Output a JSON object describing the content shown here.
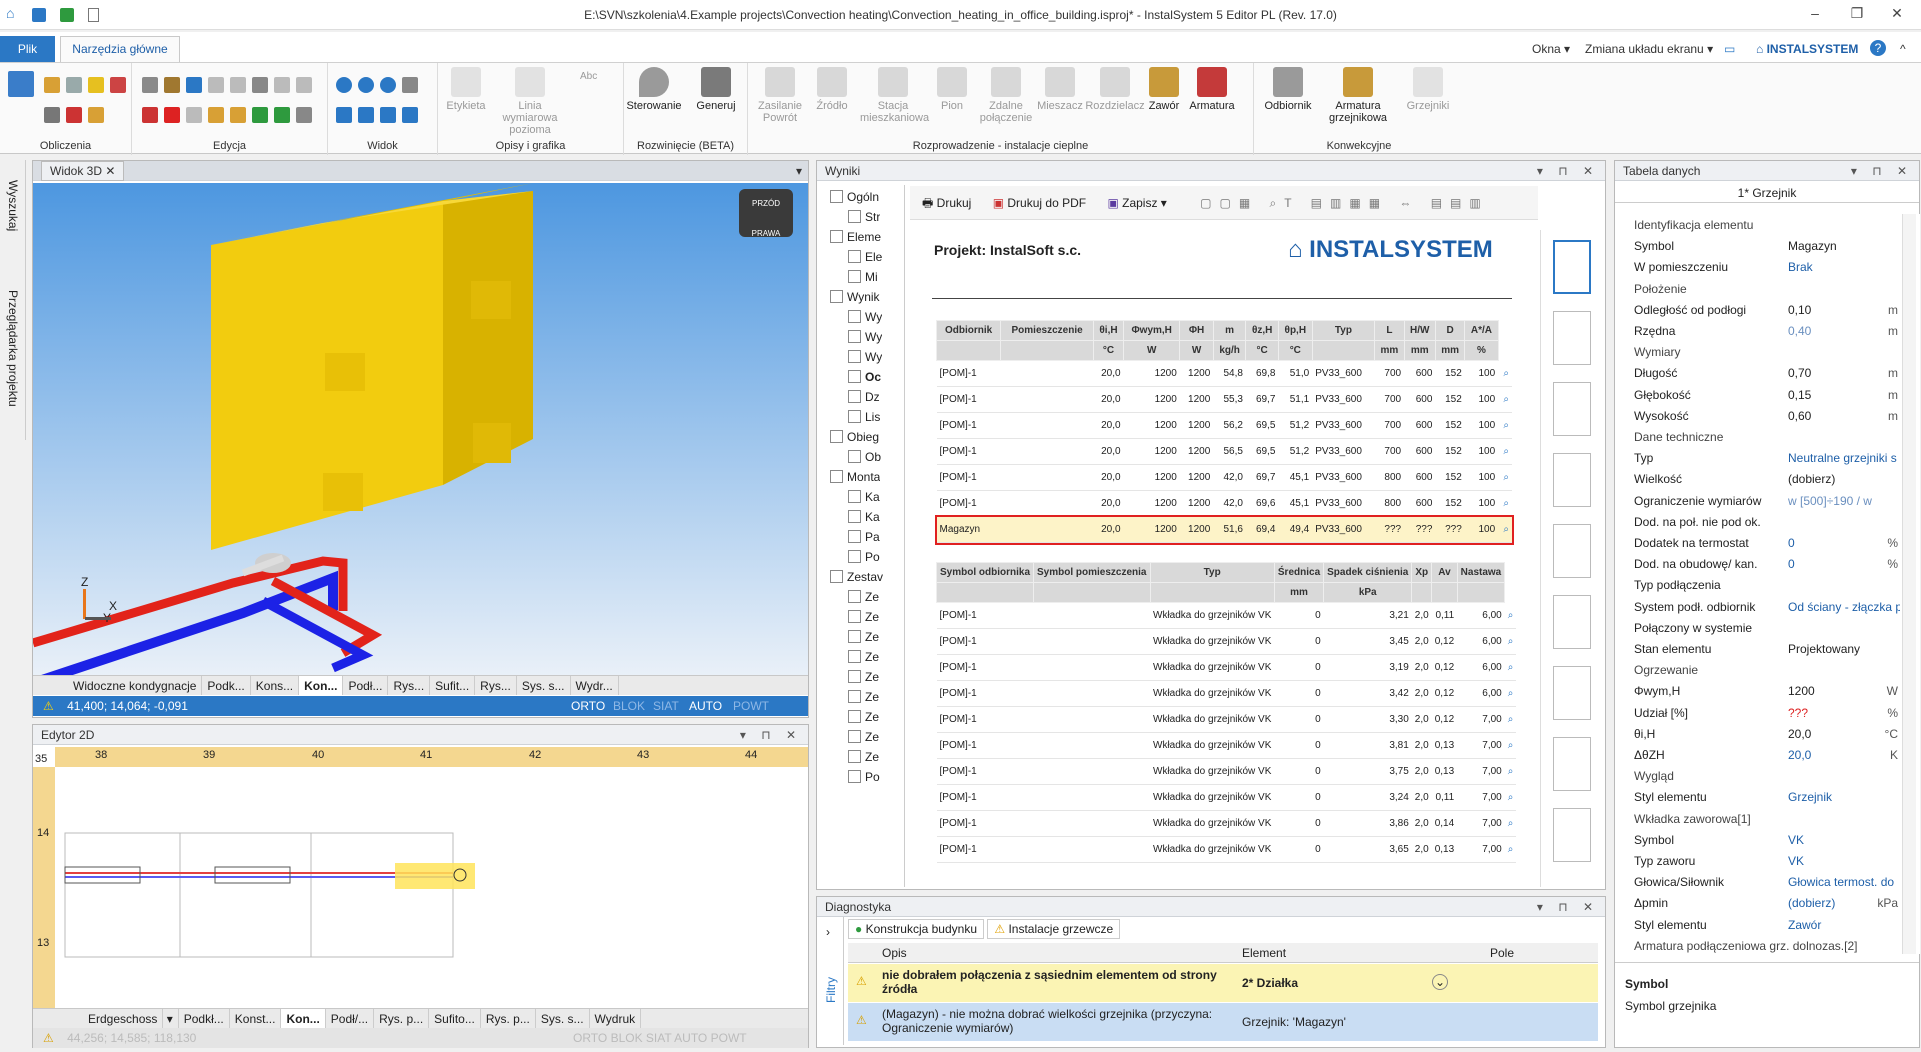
{
  "window": {
    "title": "E:\\SVN\\szkolenia\\4.Example projects\\Convection heating\\Convection_heating_in_office_building.isproj* - InstalSystem 5 Editor PL (Rev. 17.0)"
  },
  "ribbon_tabs": {
    "file": "Plik",
    "home": "Narzędzia główne",
    "okna": "Okna",
    "layout": "Zmiana układu ekranu",
    "brand": "INSTALSYSTEM"
  },
  "ribbon": {
    "groups": [
      "Obliczenia",
      "Edycja",
      "Widok",
      "Opisy i grafika",
      "Rozwinięcie (BETA)",
      "Rozprowadzenie - instalacje cieplne",
      "Konwekcyjne"
    ],
    "buttons": {
      "etykieta": "Etykieta",
      "linia": "Linia wymiarowa pozioma",
      "sterowanie": "Sterowanie",
      "generuj": "Generuj",
      "zasilanie": "Zasilanie Powrót",
      "zrodlo": "Źródło",
      "stacja": "Stacja mieszkaniowa",
      "pion": "Pion",
      "zdalne": "Zdalne połączenie",
      "mieszacz": "Mieszacz",
      "rozdzielacz": "Rozdzielacz",
      "zawor": "Zawór",
      "armatura": "Armatura",
      "odbiornik": "Odbiornik",
      "armatura_grz": "Armatura grzejnikowa",
      "grzejniki": "Grzejniki",
      "abc": "Abc"
    }
  },
  "sidebar": {
    "search": "Wyszukaj",
    "browser": "Przeglądarka projektu"
  },
  "view3d": {
    "tab": "Widok 3D",
    "cube_front": "PRZÓD",
    "cube_right": "PRAWA",
    "axes": [
      "Z",
      "X",
      "Y"
    ],
    "tabs": [
      "Widoczne kondygnacje",
      "Podk...",
      "Kons...",
      "Kon...",
      "Podł...",
      "Rys...",
      "Sufit...",
      "Rys...",
      "Sys. s...",
      "Wydr..."
    ],
    "coords": "41,400; 14,064; -0,091",
    "modes": [
      "ORTO",
      "BLOK",
      "SIAT",
      "AUTO",
      "POWT"
    ]
  },
  "editor2d": {
    "title": "Edytor 2D",
    "ruler": [
      "38",
      "39",
      "40",
      "41",
      "42",
      "43",
      "44"
    ],
    "vruler": [
      "35",
      "14",
      "13"
    ],
    "floor": "Erdgeschoss",
    "tabs": [
      "Podkł...",
      "Konst...",
      "Kon...",
      "Podł/...",
      "Rys. p...",
      "Sufito...",
      "Rys. p...",
      "Sys. s...",
      "Wydruk"
    ],
    "coords": "44,256; 14,585; 118,130",
    "modes": "ORTO BLOK SIAT AUTO POWT"
  },
  "results": {
    "title": "Wyniki",
    "toolbar": {
      "print": "Drukuj",
      "pdf": "Drukuj do PDF",
      "save": "Zapisz"
    },
    "tree": [
      "Ogóln",
      "Str",
      "Eleme",
      "Ele",
      "Mi",
      "Wynik",
      "Wy",
      "Wy",
      "Wy",
      "Oc",
      "Dz",
      "Lis",
      "Obieg",
      "Ob",
      "Monta",
      "Ka",
      "Ka",
      "Pa",
      "Po",
      "Zestav",
      "Ze",
      "Ze",
      "Ze",
      "Ze",
      "Ze",
      "Ze",
      "Ze",
      "Ze",
      "Ze",
      "Po"
    ],
    "project": "Projekt: InstalSoft s.c.",
    "logo": "INSTALSYSTEM",
    "table1": {
      "headers": [
        "Odbiornik",
        "Pomieszczenie",
        "θi,H",
        "Φwym,H",
        "ΦH",
        "m",
        "θz,H",
        "θp,H",
        "Typ",
        "L",
        "H/W",
        "D",
        "A*/A"
      ],
      "units": [
        "",
        "",
        "°C",
        "W",
        "W",
        "kg/h",
        "°C",
        "°C",
        "",
        "mm",
        "mm",
        "mm",
        "%"
      ],
      "rows": [
        [
          "[POM]-1",
          "",
          "20,0",
          "1200",
          "1200",
          "54,8",
          "69,8",
          "51,0",
          "PV33_600",
          "700",
          "600",
          "152",
          "100"
        ],
        [
          "[POM]-1",
          "",
          "20,0",
          "1200",
          "1200",
          "55,3",
          "69,7",
          "51,1",
          "PV33_600",
          "700",
          "600",
          "152",
          "100"
        ],
        [
          "[POM]-1",
          "",
          "20,0",
          "1200",
          "1200",
          "56,2",
          "69,5",
          "51,2",
          "PV33_600",
          "700",
          "600",
          "152",
          "100"
        ],
        [
          "[POM]-1",
          "",
          "20,0",
          "1200",
          "1200",
          "56,5",
          "69,5",
          "51,2",
          "PV33_600",
          "700",
          "600",
          "152",
          "100"
        ],
        [
          "[POM]-1",
          "",
          "20,0",
          "1200",
          "1200",
          "42,0",
          "69,7",
          "45,1",
          "PV33_600",
          "800",
          "600",
          "152",
          "100"
        ],
        [
          "[POM]-1",
          "",
          "20,0",
          "1200",
          "1200",
          "42,0",
          "69,6",
          "45,1",
          "PV33_600",
          "800",
          "600",
          "152",
          "100"
        ],
        [
          "Magazyn",
          "",
          "20,0",
          "1200",
          "1200",
          "51,6",
          "69,4",
          "49,4",
          "PV33_600",
          "???",
          "???",
          "???",
          "100"
        ]
      ]
    },
    "table2": {
      "headers": [
        "Symbol odbiornika",
        "Symbol pomieszczenia",
        "Typ",
        "Średnica",
        "Spadek ciśnienia",
        "Xp",
        "Av",
        "Nastawa"
      ],
      "units": [
        "",
        "",
        "",
        "mm",
        "kPa",
        "",
        "",
        ""
      ],
      "rows": [
        [
          "[POM]-1",
          "",
          "Wkładka do grzejników VK",
          "0",
          "3,21",
          "2,0",
          "0,11",
          "6,00"
        ],
        [
          "[POM]-1",
          "",
          "Wkładka do grzejników VK",
          "0",
          "3,45",
          "2,0",
          "0,12",
          "6,00"
        ],
        [
          "[POM]-1",
          "",
          "Wkładka do grzejników VK",
          "0",
          "3,19",
          "2,0",
          "0,12",
          "6,00"
        ],
        [
          "[POM]-1",
          "",
          "Wkładka do grzejników VK",
          "0",
          "3,42",
          "2,0",
          "0,12",
          "6,00"
        ],
        [
          "[POM]-1",
          "",
          "Wkładka do grzejników VK",
          "0",
          "3,30",
          "2,0",
          "0,12",
          "7,00"
        ],
        [
          "[POM]-1",
          "",
          "Wkładka do grzejników VK",
          "0",
          "3,81",
          "2,0",
          "0,13",
          "7,00"
        ],
        [
          "[POM]-1",
          "",
          "Wkładka do grzejników VK",
          "0",
          "3,75",
          "2,0",
          "0,13",
          "7,00"
        ],
        [
          "[POM]-1",
          "",
          "Wkładka do grzejników VK",
          "0",
          "3,24",
          "2,0",
          "0,11",
          "7,00"
        ],
        [
          "[POM]-1",
          "",
          "Wkładka do grzejników VK",
          "0",
          "3,86",
          "2,0",
          "0,14",
          "7,00"
        ],
        [
          "[POM]-1",
          "",
          "Wkładka do grzejników VK",
          "0",
          "3,65",
          "2,0",
          "0,13",
          "7,00"
        ]
      ]
    }
  },
  "diagnostics": {
    "title": "Diagnostyka",
    "tab1": "Konstrukcja budynku",
    "tab2": "Instalacje grzewcze",
    "filters": "Filtry",
    "headers": [
      "Opis",
      "Element",
      "Pole"
    ],
    "rows": [
      {
        "opis": "nie dobrałem połączenia z sąsiednim elementem od strony źródła",
        "element": "2* Działka"
      },
      {
        "opis": "(Magazyn) - nie można dobrać wielkości grzejnika (przyczyna: Ograniczenie wymiarów)",
        "element": "Grzejnik: 'Magazyn'"
      }
    ]
  },
  "props": {
    "title": "Tabela danych",
    "object": "1* Grzejnik",
    "items": [
      {
        "cat": "Identyfikacja elementu"
      },
      {
        "l": "Symbol",
        "v": "Magazyn",
        "c": "#222"
      },
      {
        "l": "W pomieszczeniu",
        "v": "Brak"
      },
      {
        "cat": "Położenie"
      },
      {
        "l": "Odległość od podłogi",
        "v": "0,10",
        "u": "m",
        "c": "#222"
      },
      {
        "l": "Rzędna",
        "v": "0,40",
        "u": "m",
        "c": "#6a8fbf"
      },
      {
        "cat": "Wymiary"
      },
      {
        "l": "Długość",
        "v": "0,70",
        "u": "m",
        "c": "#222"
      },
      {
        "l": "Głębokość",
        "v": "0,15",
        "u": "m",
        "c": "#222"
      },
      {
        "l": "Wysokość",
        "v": "0,60",
        "u": "m",
        "c": "#222"
      },
      {
        "cat": "Dane techniczne"
      },
      {
        "l": "Typ",
        "v": "Neutralne grzejniki s"
      },
      {
        "l": "Wielkość",
        "v": "(dobierz)",
        "c": "#222"
      },
      {
        "l": "Ograniczenie wymiarów",
        "v": "w [500]÷190 / w",
        "c": "#6a8fbf"
      },
      {
        "l": "Dod. na poł. nie pod ok.",
        "v": ""
      },
      {
        "l": "Dodatek na termostat",
        "v": "0",
        "u": "%"
      },
      {
        "l": "Dod. na obudowę/ kan.",
        "v": "0",
        "u": "%"
      },
      {
        "l": "Typ podłączenia",
        "v": ""
      },
      {
        "l": "System podł. odbiornik",
        "v": "Od ściany - złączka p"
      },
      {
        "l": "Połączony w systemie",
        "v": ""
      },
      {
        "l": "Stan elementu",
        "v": "Projektowany",
        "c": "#222"
      },
      {
        "cat": "Ogrzewanie"
      },
      {
        "l": "Φwym,H",
        "v": "1200",
        "u": "W",
        "c": "#222"
      },
      {
        "l": "Udział [%]",
        "v": "???",
        "u": "%",
        "c": "#d22"
      },
      {
        "l": "θi,H",
        "v": "20,0",
        "u": "°C",
        "c": "#222"
      },
      {
        "l": "ΔθZH",
        "v": "20,0",
        "u": "K"
      },
      {
        "cat": "Wygląd"
      },
      {
        "l": "Styl elementu",
        "v": "Grzejnik"
      },
      {
        "cat": "Wkładka zaworowa[1]"
      },
      {
        "l": "Symbol",
        "v": "VK"
      },
      {
        "l": "Typ zaworu",
        "v": "VK"
      },
      {
        "l": "Głowica/Siłownik",
        "v": "Głowica termost. do"
      },
      {
        "l": "Δpmin",
        "v": "(dobierz)",
        "u": "kPa"
      },
      {
        "l": "Styl elementu",
        "v": "Zawór"
      },
      {
        "cat": "Armatura podłączeniowa grz. dolnozas.[2]"
      }
    ],
    "footer_title": "Symbol",
    "footer_desc": "Symbol grzejnika"
  }
}
